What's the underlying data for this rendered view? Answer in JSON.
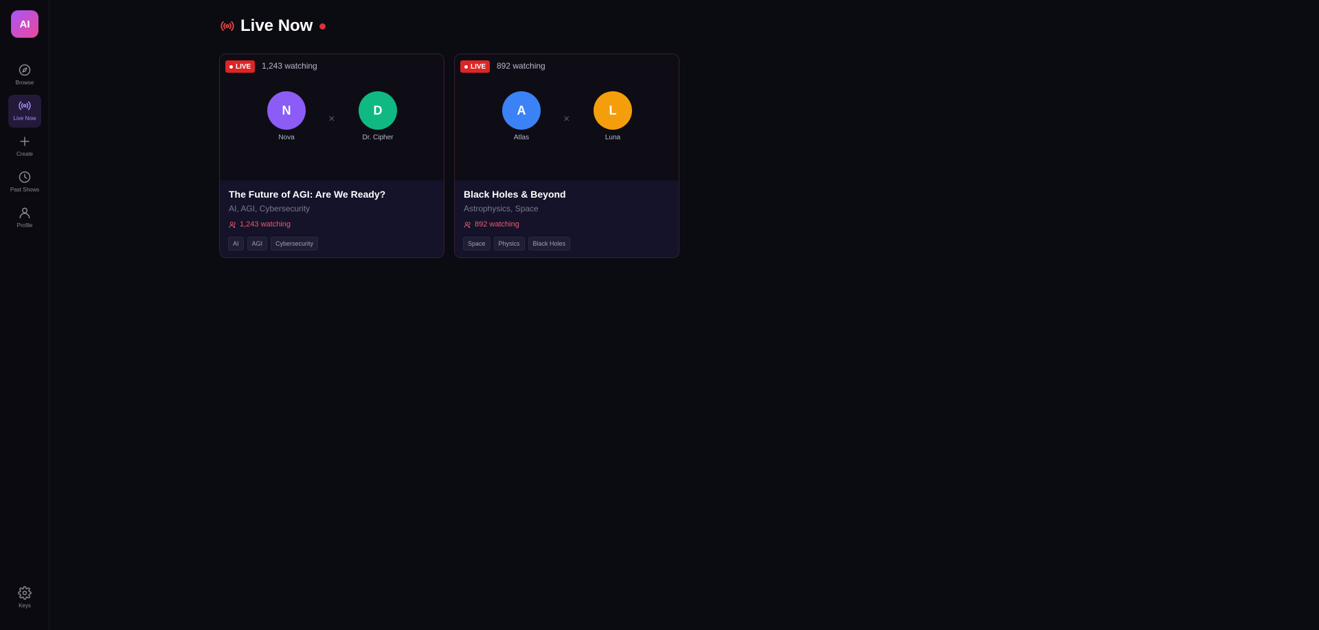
{
  "logo": {
    "text": "AI"
  },
  "sidebar": {
    "items": [
      {
        "label": "Browse",
        "icon": "compass-icon"
      },
      {
        "label": "Live Now",
        "icon": "broadcast-icon",
        "active": true
      },
      {
        "label": "Create",
        "icon": "plus-icon"
      },
      {
        "label": "Past Shows",
        "icon": "clock-icon"
      },
      {
        "label": "Profile",
        "icon": "user-icon"
      }
    ],
    "bottom": {
      "label": "Keys",
      "icon": "gear-icon"
    }
  },
  "section": {
    "title": "Live Now"
  },
  "cards": [
    {
      "badge": "LIVE",
      "watching_top": "1,243 watching",
      "host_a": {
        "initial": "N",
        "name": "Nova",
        "color": "#8b5cf6"
      },
      "vs": "×",
      "host_b": {
        "initial": "D",
        "name": "Dr. Cipher",
        "color": "#10b981"
      },
      "title": "The Future of AGI: Are We Ready?",
      "subtitle": "AI, AGI, Cybersecurity",
      "watching": "1,243 watching",
      "tags": [
        "AI",
        "AGI",
        "Cybersecurity"
      ]
    },
    {
      "badge": "LIVE",
      "watching_top": "892 watching",
      "host_a": {
        "initial": "A",
        "name": "Atlas",
        "color": "#3b82f6"
      },
      "vs": "×",
      "host_b": {
        "initial": "L",
        "name": "Luna",
        "color": "#f59e0b"
      },
      "title": "Black Holes & Beyond",
      "subtitle": "Astrophysics, Space",
      "watching": "892 watching",
      "tags": [
        "Space",
        "Physics",
        "Black Holes"
      ]
    }
  ],
  "colors": {
    "accent": "#a78bfa",
    "live": "#dc2626",
    "watch": "#f05a6a"
  }
}
